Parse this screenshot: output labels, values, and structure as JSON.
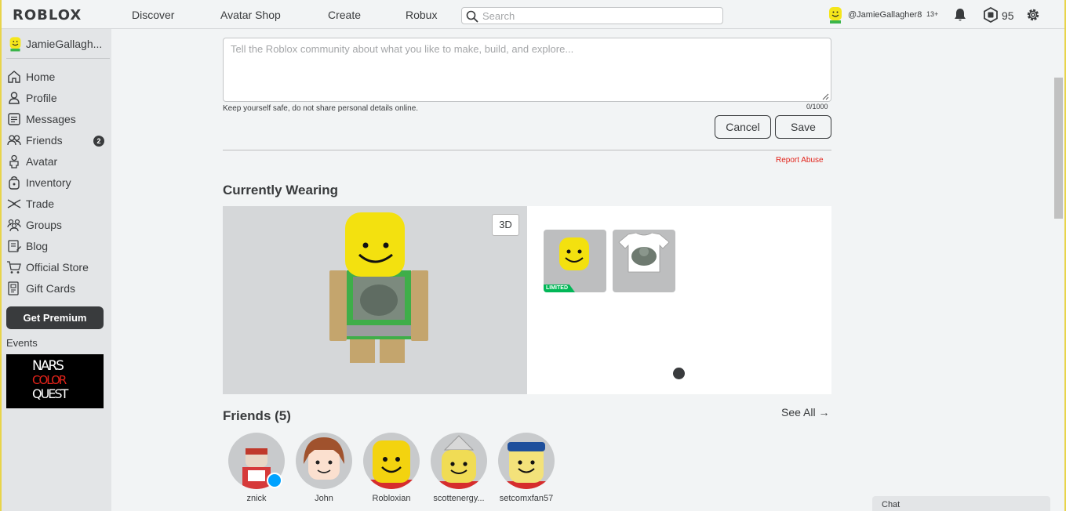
{
  "topbar": {
    "logo": "ROBLOX",
    "nav": [
      "Discover",
      "Avatar Shop",
      "Create",
      "Robux"
    ],
    "search_placeholder": "Search",
    "username": "@JamieGallagher8",
    "age_tag": "13+",
    "robux": "95"
  },
  "sidebar": {
    "username": "JamieGallagh...",
    "items": [
      {
        "label": "Home",
        "icon": "home-icon"
      },
      {
        "label": "Profile",
        "icon": "profile-icon"
      },
      {
        "label": "Messages",
        "icon": "messages-icon"
      },
      {
        "label": "Friends",
        "icon": "friends-icon",
        "badge": "2"
      },
      {
        "label": "Avatar",
        "icon": "avatar-icon"
      },
      {
        "label": "Inventory",
        "icon": "inventory-icon"
      },
      {
        "label": "Trade",
        "icon": "trade-icon"
      },
      {
        "label": "Groups",
        "icon": "groups-icon"
      },
      {
        "label": "Blog",
        "icon": "blog-icon"
      },
      {
        "label": "Official Store",
        "icon": "store-icon"
      },
      {
        "label": "Gift Cards",
        "icon": "gift-card-icon"
      }
    ],
    "premium_label": "Get Premium",
    "events_label": "Events",
    "event_banner": {
      "line1": "NARS",
      "line2": "COLOR",
      "line3": "QUEST"
    }
  },
  "about": {
    "placeholder": "Tell the Roblox community about what you like to make, build, and explore...",
    "value": "",
    "safety_note": "Keep yourself safe, do not share personal details online.",
    "char_count": "0/1000",
    "cancel_label": "Cancel",
    "save_label": "Save",
    "report_label": "Report Abuse"
  },
  "wearing": {
    "title": "Currently Wearing",
    "view_3d_label": "3D",
    "limited_label": "LIMITED"
  },
  "friends": {
    "title": "Friends (5)",
    "see_all": "See All",
    "list": [
      {
        "name": "znick"
      },
      {
        "name": "John"
      },
      {
        "name": "Robloxian"
      },
      {
        "name": "scottenergy..."
      },
      {
        "name": "setcomxfan57"
      }
    ]
  },
  "chat": {
    "label": "Chat"
  },
  "colors": {
    "accent_dark": "#393b3d",
    "limited_green": "#02b757",
    "report_red": "#e2231a",
    "online_blue": "#00a2ff"
  }
}
